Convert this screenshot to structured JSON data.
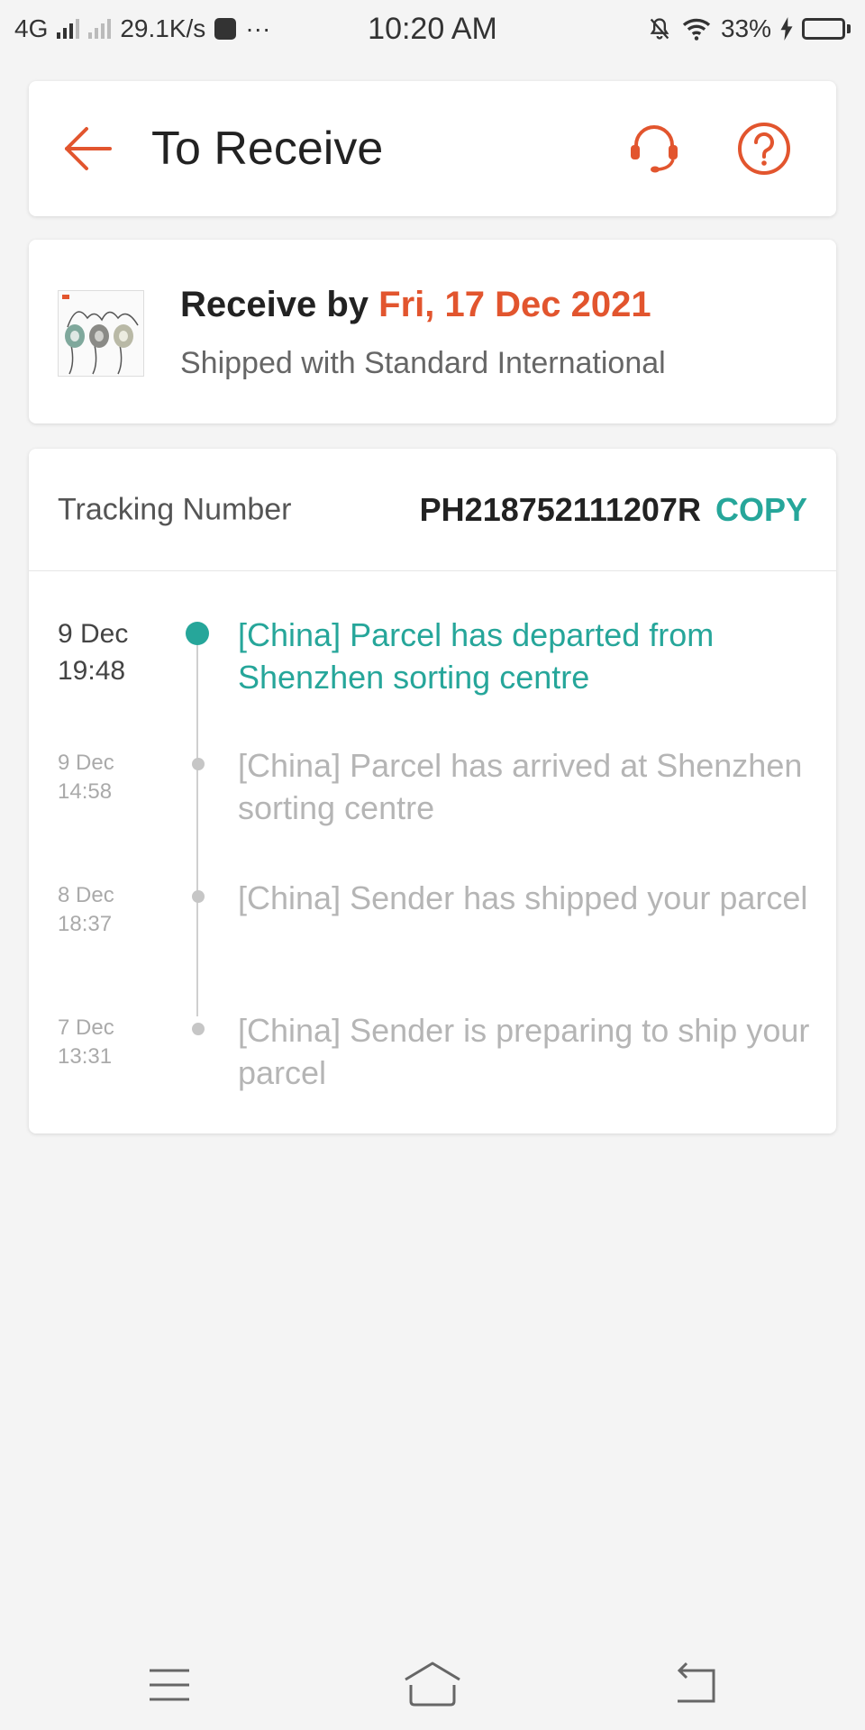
{
  "status_bar": {
    "network": "4G",
    "speed": "29.1K/s",
    "more": "···",
    "time": "10:20 AM",
    "battery": "33%"
  },
  "header": {
    "title": "To Receive",
    "back_icon": "arrow-left-icon",
    "support_icon": "headset-icon",
    "help_icon": "question-circle-icon"
  },
  "delivery": {
    "receive_prefix": "Receive by",
    "receive_date": "Fri, 17 Dec 2021",
    "shipping_method": "Shipped with Standard International"
  },
  "tracking": {
    "label": "Tracking Number",
    "number": "PH218752111207R",
    "copy_label": "COPY",
    "events": [
      {
        "day": "9 Dec",
        "time": "19:48",
        "text": "[China] Parcel has departed from Shenzhen sorting centre"
      },
      {
        "day": "9 Dec",
        "time": "14:58",
        "text": "[China] Parcel has arrived at Shenzhen sorting centre"
      },
      {
        "day": "8 Dec",
        "time": "18:37",
        "text": "[China] Sender has shipped your parcel"
      },
      {
        "day": "7 Dec",
        "time": "13:31",
        "text": "[China] Sender is preparing to ship your parcel"
      }
    ]
  },
  "colors": {
    "accent_orange": "#e2552e",
    "accent_teal": "#26a69a"
  }
}
